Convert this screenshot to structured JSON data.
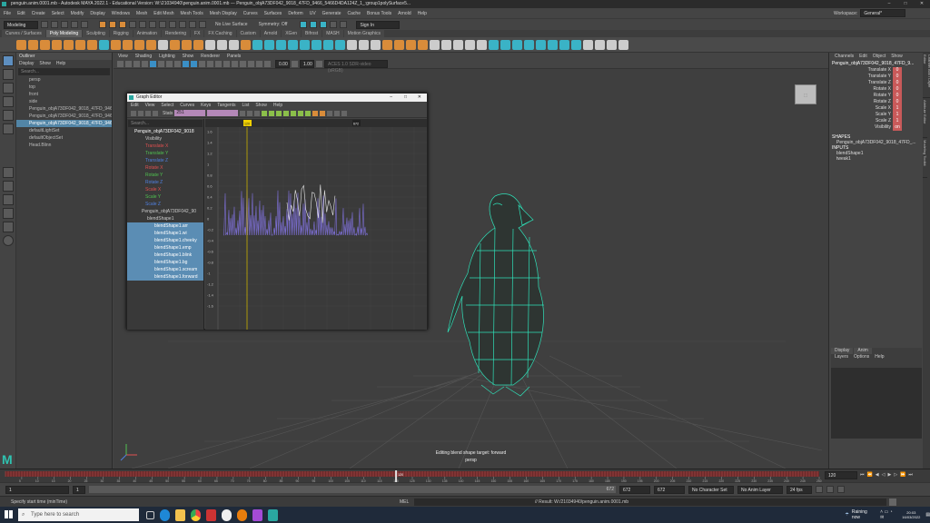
{
  "window": {
    "title": "penguin.anim.0001.mb - Autodesk MAYA 2022.1 - Educational Version: W:\\21034940\\penguin.anim.0001.mb  ---  Penguin_objA73DF042_9018_47FD_9466_5466D4DA124Z_1_:group1polySurface5..."
  },
  "menubar": {
    "items": [
      "File",
      "Edit",
      "Create",
      "Select",
      "Modify",
      "Display",
      "Windows",
      "Mesh",
      "Edit Mesh",
      "Mesh Tools",
      "Mesh Display",
      "Curves",
      "Surfaces",
      "Deform",
      "UV",
      "Generate",
      "Cache",
      "Bonus Tools",
      "Arnold",
      "Help"
    ],
    "workspace_label": "Workspace:",
    "workspace_value": "General*"
  },
  "statusline": {
    "mode": "Modeling",
    "live_surface": "No Live Surface",
    "symmetry": "Symmetry: Off",
    "sign_in": "Sign In"
  },
  "shelf_tabs": [
    "Curves / Surfaces",
    "Poly Modeling",
    "Sculpting",
    "Rigging",
    "Animation",
    "Rendering",
    "FX",
    "FX Caching",
    "Custom",
    "Arnold",
    "XGen",
    "Bifrost",
    "MASH",
    "Motion Graphics"
  ],
  "shelf_active": 1,
  "outliner": {
    "title": "Outliner",
    "menu": [
      "Display",
      "Show",
      "Help"
    ],
    "search_placeholder": "Search...",
    "items": [
      {
        "label": "persp",
        "sel": false
      },
      {
        "label": "top",
        "sel": false
      },
      {
        "label": "front",
        "sel": false
      },
      {
        "label": "side",
        "sel": false
      },
      {
        "label": "Penguin_objA73DF042_9018_47FD_9466...",
        "sel": false
      },
      {
        "label": "Penguin_objA73DF042_9018_47FD_9466...",
        "sel": false
      },
      {
        "label": "Penguin_objA73DF042_9018_47FD_9466...",
        "sel": true
      },
      {
        "label": "defaultLightSet",
        "sel": false
      },
      {
        "label": "defaultObjectSet",
        "sel": false
      },
      {
        "label": "Head.Blinn",
        "sel": false
      }
    ]
  },
  "viewport": {
    "menu": [
      "View",
      "Shading",
      "Lighting",
      "Show",
      "Renderer",
      "Panels"
    ],
    "field_a": "0.00",
    "field_b": "1.00",
    "colorspace": "ACES 1.0 SDR-video (sRGB)",
    "hud_line1": "Editing blend shape target: forward",
    "hud_line2": "persp"
  },
  "graph_editor": {
    "title": "Graph Editor",
    "menu": [
      "Edit",
      "View",
      "Select",
      "Curves",
      "Keys",
      "Tangents",
      "List",
      "Show",
      "Help"
    ],
    "stats_label": "Stats",
    "field_value": "251",
    "search_placeholder": "Search...",
    "object": "Penguin_objA73DF042_9018",
    "channels": [
      {
        "label": "Visibility",
        "color": "#cccccc"
      },
      {
        "label": "Translate X",
        "color": "#e05050"
      },
      {
        "label": "Translate Y",
        "color": "#50c050"
      },
      {
        "label": "Translate Z",
        "color": "#5080e0"
      },
      {
        "label": "Rotate X",
        "color": "#e05050"
      },
      {
        "label": "Rotate Y",
        "color": "#50c050"
      },
      {
        "label": "Rotate Z",
        "color": "#5080e0"
      },
      {
        "label": "Scale X",
        "color": "#e05050"
      },
      {
        "label": "Scale Y",
        "color": "#50c050"
      },
      {
        "label": "Scale Z",
        "color": "#5080e0"
      }
    ],
    "sub_object": "Penguin_objA73DF042_90",
    "sub_node": "blendShape1",
    "blend_items": [
      "blendShape1.arr",
      "blendShape1.wi",
      "blendShape1.cheeky",
      "blendShape1.emp",
      "blendShape1.blink",
      "blendShape1.bg",
      "blendShape1.scream",
      "blendShape1.forward"
    ],
    "y_ticks": [
      "1.6",
      "1.4",
      "1.2",
      "1",
      "0.8",
      "0.6",
      "0.4",
      "0.2",
      "0",
      "-0.2",
      "-0.4",
      "-0.6",
      "-0.8",
      "-1",
      "-1.2",
      "-1.4",
      "-1.6"
    ],
    "time_marker": "120",
    "time_marker2": "672"
  },
  "channel_box": {
    "menu": [
      "Channels",
      "Edit",
      "Object",
      "Show"
    ],
    "object": "Penguin_objA73DF042_9018_47FD_9...",
    "attributes": [
      {
        "name": "Translate X",
        "value": "0"
      },
      {
        "name": "Translate Y",
        "value": "0"
      },
      {
        "name": "Translate Z",
        "value": "0"
      },
      {
        "name": "Rotate X",
        "value": "0"
      },
      {
        "name": "Rotate Y",
        "value": "0"
      },
      {
        "name": "Rotate Z",
        "value": "0"
      },
      {
        "name": "Scale X",
        "value": "1"
      },
      {
        "name": "Scale Y",
        "value": "1"
      },
      {
        "name": "Scale Z",
        "value": "1"
      },
      {
        "name": "Visibility",
        "value": "on"
      }
    ],
    "shapes_label": "SHAPES",
    "shape_name": "Penguin_objA73DF042_9018_47FD_...",
    "inputs_label": "INPUTS",
    "inputs": [
      "blendShape1",
      "tweak1"
    ],
    "side_tabs": [
      "Channel Box / Layer Editor",
      "Attribute Editor",
      "Modeling Toolkit"
    ]
  },
  "layers": {
    "tabs": [
      "Display",
      "Anim"
    ],
    "menu": [
      "Layers",
      "Options",
      "Help"
    ]
  },
  "timeline": {
    "ticks": [
      "5",
      "10",
      "15",
      "20",
      "25",
      "30",
      "35",
      "40",
      "45",
      "50",
      "55",
      "60",
      "65",
      "70",
      "75",
      "80",
      "85",
      "90",
      "95",
      "100",
      "105",
      "110",
      "115",
      "120",
      "125",
      "130",
      "135",
      "140",
      "145",
      "150",
      "155",
      "160",
      "165",
      "170",
      "175",
      "180",
      "185",
      "190",
      "195",
      "200",
      "205",
      "210",
      "215",
      "220",
      "225",
      "230",
      "235",
      "240",
      "245",
      "250"
    ],
    "current_frame": "120",
    "right_field": "120",
    "range_start": "1",
    "range_start2": "1",
    "range_end": "672",
    "range_end2": "672",
    "range_end3": "672",
    "character_set": "No Character Set",
    "anim_layer": "No Anim Layer",
    "fps": "24 fps"
  },
  "command_line": {
    "status": "Specify start time (minTime)",
    "lang": "MEL",
    "result": "// Result: W:/21034940/penguin.anim.0001.mb"
  },
  "taskbar": {
    "search_placeholder": "Type here to search",
    "weather": "Raining now",
    "time": "20:03",
    "date": "16/03/2022"
  },
  "maya_logo": "M"
}
